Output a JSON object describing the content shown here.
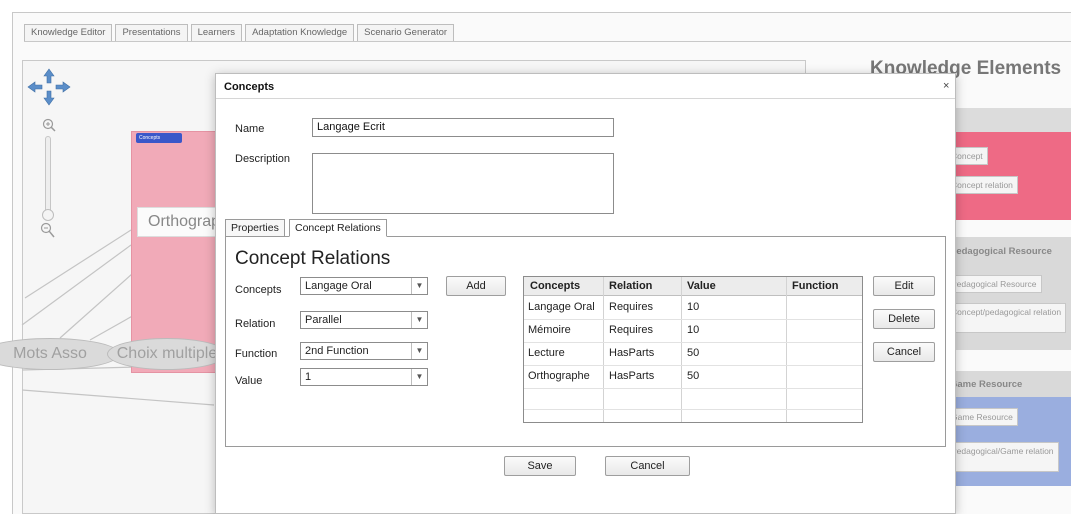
{
  "main_tabs": [
    "Knowledge Editor",
    "Presentations",
    "Learners",
    "Adaptation Knowledge",
    "Scenario Generator"
  ],
  "background": {
    "panel_title": "Knowledge Elements",
    "concept_node_badge": "Concepts",
    "node_orthographe": "Orthographe",
    "node_mots": "Mots Asso",
    "node_choix": "Choix multiple",
    "concept_buttons": [
      "Concept",
      "Concept relation"
    ],
    "pedagogical_section": "Pedagogical Resource",
    "pedagogical_buttons": [
      "Pedagogical Resource",
      "Concept/pedagogical relation"
    ],
    "game_section": "Game Resource",
    "game_buttons": [
      "Game Resource",
      "Pedagogical/Game relation"
    ]
  },
  "dialog": {
    "title": "Concepts",
    "close": "×",
    "name_label": "Name",
    "name_value": "Langage Ecrit",
    "description_label": "Description",
    "description_value": "",
    "tabs": {
      "properties": "Properties",
      "relations": "Concept Relations"
    },
    "section_title": "Concept Relations",
    "fields": {
      "concepts": {
        "label": "Concepts",
        "value": "Langage  Oral"
      },
      "relation": {
        "label": "Relation",
        "value": "Parallel"
      },
      "function": {
        "label": "Function",
        "value": "2nd Function"
      },
      "value": {
        "label": "Value",
        "value": "1"
      }
    },
    "add_label": "Add",
    "table": {
      "headers": [
        "Concepts",
        "Relation",
        "Value",
        "Function"
      ],
      "rows": [
        [
          "Langage  Oral",
          "Requires",
          "10",
          ""
        ],
        [
          "Mémoire",
          "Requires",
          "10",
          ""
        ],
        [
          "Lecture",
          "HasParts",
          "50",
          ""
        ],
        [
          "Orthographe",
          "HasParts",
          "50",
          ""
        ],
        [
          "",
          "",
          "",
          ""
        ]
      ]
    },
    "edit_label": "Edit",
    "delete_label": "Delete",
    "cancel_row_label": "Cancel",
    "save_label": "Save",
    "cancel_label": "Cancel"
  },
  "icons": {
    "pan": "pan-arrows-icon",
    "zoom_in": "zoom-in-icon",
    "zoom_out": "zoom-out-icon",
    "dropdown": "chevron-down-icon"
  }
}
